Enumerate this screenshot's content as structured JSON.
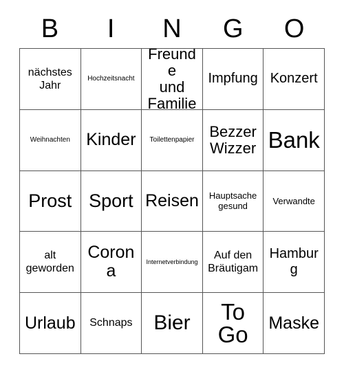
{
  "card": {
    "header": {
      "letters": [
        "B",
        "I",
        "N",
        "G",
        "O"
      ]
    },
    "colors": {
      "text": "#000000",
      "border": "#555555",
      "background": "#ffffff"
    },
    "rows": [
      [
        {
          "text": "nächstes\nJahr",
          "size": "fs-lg"
        },
        {
          "text": "Hochzeitsnacht",
          "size": "fs-sm"
        },
        {
          "text": "Freunde\nund\nFamilie",
          "size": "fs-2xl"
        },
        {
          "text": "Impfung",
          "size": "fs-xl"
        },
        {
          "text": "Konzert",
          "size": "fs-xl"
        }
      ],
      [
        {
          "text": "Weihnachten",
          "size": "fs-sm"
        },
        {
          "text": "Kinder",
          "size": "fs-3xl"
        },
        {
          "text": "Toilettenpapier",
          "size": "fs-sm"
        },
        {
          "text": "Bezzer\nWizzer",
          "size": "fs-2xl"
        },
        {
          "text": "Bank",
          "size": "fs-6xl"
        }
      ],
      [
        {
          "text": "Prost",
          "size": "fs-4xl"
        },
        {
          "text": "Sport",
          "size": "fs-4xl"
        },
        {
          "text": "Reisen",
          "size": "fs-3xl"
        },
        {
          "text": "Hauptsache\ngesund",
          "size": "fs-md"
        },
        {
          "text": "Verwandte",
          "size": "fs-md"
        }
      ],
      [
        {
          "text": "alt\ngeworden",
          "size": "fs-lg"
        },
        {
          "text": "Corona",
          "size": "fs-3xl"
        },
        {
          "text": "Internetverbindung",
          "size": "fs-xs"
        },
        {
          "text": "Auf den\nBräutigam",
          "size": "fs-lg"
        },
        {
          "text": "Hamburg",
          "size": "fs-xl"
        }
      ],
      [
        {
          "text": "Urlaub",
          "size": "fs-3xl"
        },
        {
          "text": "Schnaps",
          "size": "fs-lg"
        },
        {
          "text": "Bier",
          "size": "fs-5xl"
        },
        {
          "text": "To\nGo",
          "size": "fs-6xl"
        },
        {
          "text": "Maske",
          "size": "fs-3xl"
        }
      ]
    ]
  }
}
